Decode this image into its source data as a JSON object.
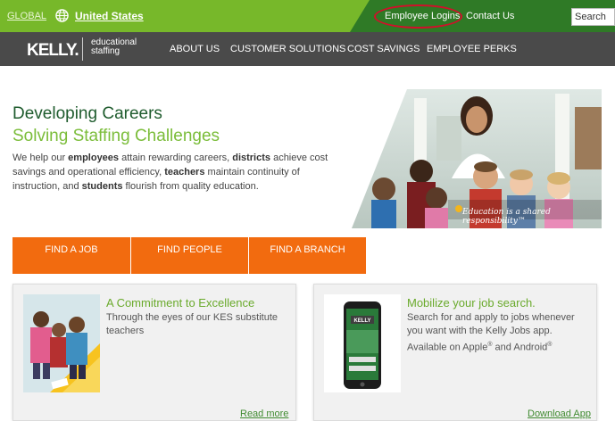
{
  "topbar": {
    "global": "GLOBAL",
    "country": "United States",
    "employee_logins": "Employee Logins",
    "contact_us": "Contact Us",
    "search": "Search"
  },
  "nav": {
    "logo": "KELLY.",
    "logo_sub_line1": "educational",
    "logo_sub_line2": "staffing",
    "items": [
      "ABOUT US",
      "CUSTOMER SOLUTIONS",
      "COST SAVINGS",
      "EMPLOYEE PERKS"
    ]
  },
  "hero": {
    "title1": "Developing Careers",
    "title2": "Solving Staffing Challenges",
    "p": {
      "a": "We help our ",
      "b": "employees",
      "c": " attain rewarding careers, ",
      "d": "districts",
      "e": " achieve cost savings and operational efficiency, ",
      "f": "teachers",
      "g": " maintain continuity of instruction, and ",
      "h": "students",
      "i": " flourish from quality education."
    },
    "tagline": "Education is a shared responsibility™"
  },
  "find": [
    "FIND A JOB",
    "FIND PEOPLE",
    "FIND A BRANCH"
  ],
  "card1": {
    "title": "A Commitment to Excellence",
    "text1": "Through the eyes of our KES substitute",
    "text2": "teachers",
    "link": "Read more"
  },
  "card2": {
    "title": "Mobilize your job search.",
    "text1": "Search for and apply to jobs whenever",
    "text2": "you want with the Kelly Jobs app.",
    "text3a": "Available on Apple",
    "reg1": "®",
    "text3b": " and Android",
    "reg2": "®",
    "link": "Download App",
    "phone_logo": "KELLY"
  },
  "colors": {
    "green_bar": "#77b82a",
    "dark_green": "#2f7a26",
    "nav_gray": "#4a4a4a",
    "orange": "#f26b0f",
    "title_green": "#1f5c2e",
    "accent_green": "#7bbd3a",
    "highlight_red": "#d0102a"
  }
}
